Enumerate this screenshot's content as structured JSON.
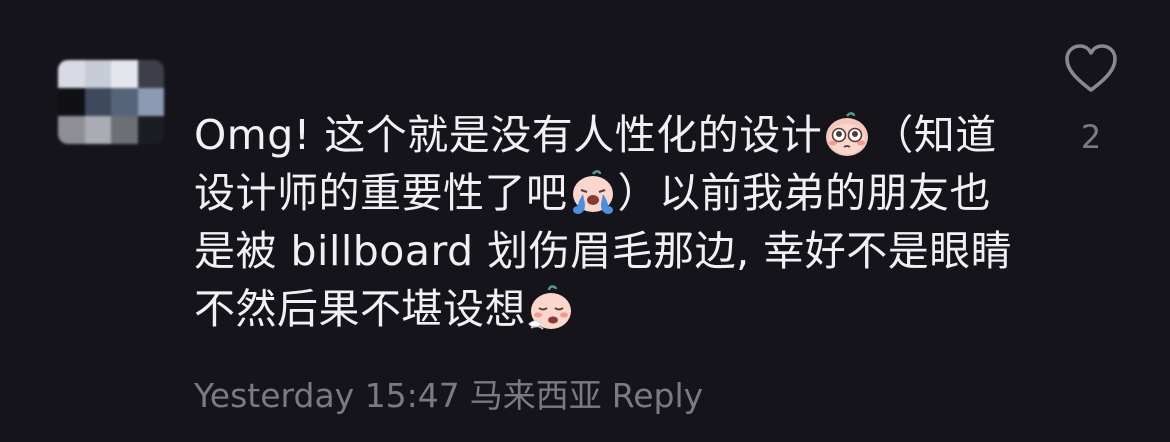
{
  "comment": {
    "avatar_pixels": [
      "#d8dbe4",
      "#c8ccd6",
      "#e4e6ec",
      "#3d4048",
      "#101015",
      "#3e4a5c",
      "#56647a",
      "#8a9ab2",
      "#8e8f95",
      "#a9acb2",
      "#6c6f73",
      "#1c1d22"
    ],
    "line1": "Omg! 这个就是没有人性化的设计",
    "line1b": "（知道",
    "line2": "设计师的重要性了吧",
    "line2b": "）以前我弟的朋友也",
    "line3": "是被 billboard 划伤眉毛那边, 幸好不是眼睛",
    "line4": "不然后果不堪设想",
    "emoji_1": "pleading-face-emoji",
    "emoji_2": "crying-face-emoji",
    "emoji_3": "exhausted-face-emoji",
    "timestamp": "Yesterday 15:47",
    "location": "马来西亚",
    "reply_label": "Reply"
  },
  "like": {
    "icon": "heart-outline-icon",
    "count": "2"
  },
  "colors": {
    "background": "#16141b",
    "text": "#f2f0f4",
    "meta": "#7c7a80"
  }
}
